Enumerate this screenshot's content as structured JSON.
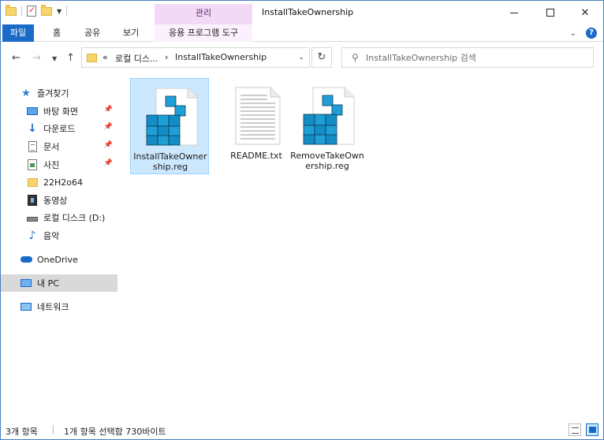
{
  "window": {
    "title": "InstallTakeOwnership",
    "context_tab_label": "관리"
  },
  "ribbon": {
    "tabs": [
      {
        "label": "파일"
      },
      {
        "label": "홈"
      },
      {
        "label": "공유"
      },
      {
        "label": "보기"
      },
      {
        "label": "응용 프로그램 도구"
      }
    ]
  },
  "address": {
    "overflow": "«",
    "crumbs": [
      "로컬 디스...",
      "InstallTakeOwnership"
    ],
    "separator": "›"
  },
  "search": {
    "placeholder": "InstallTakeOwnership 검색"
  },
  "nav": {
    "quick_access": "즐겨찾기",
    "items": [
      {
        "label": "바탕 화면",
        "pinned": true
      },
      {
        "label": "다운로드",
        "pinned": true
      },
      {
        "label": "문서",
        "pinned": true
      },
      {
        "label": "사진",
        "pinned": true
      },
      {
        "label": "22H2o64",
        "pinned": false
      },
      {
        "label": "동영상",
        "pinned": false
      },
      {
        "label": "로컬 디스크 (D:)",
        "pinned": false
      },
      {
        "label": "음악",
        "pinned": false
      }
    ],
    "onedrive": "OneDrive",
    "this_pc": "내 PC",
    "network": "네트워크"
  },
  "files": [
    {
      "name": "InstallTakeOwnership.reg",
      "type": "reg",
      "selected": true
    },
    {
      "name": "README.txt",
      "type": "txt",
      "selected": false
    },
    {
      "name": "RemoveTakeOwnership.reg",
      "type": "reg",
      "selected": false
    }
  ],
  "status": {
    "count": "3개 항목",
    "selection": "1개 항목 선택함 730바이트"
  },
  "colors": {
    "accent": "#1a6bc7",
    "context_tab": "#f2d9f5",
    "selection": "#cce8ff"
  }
}
